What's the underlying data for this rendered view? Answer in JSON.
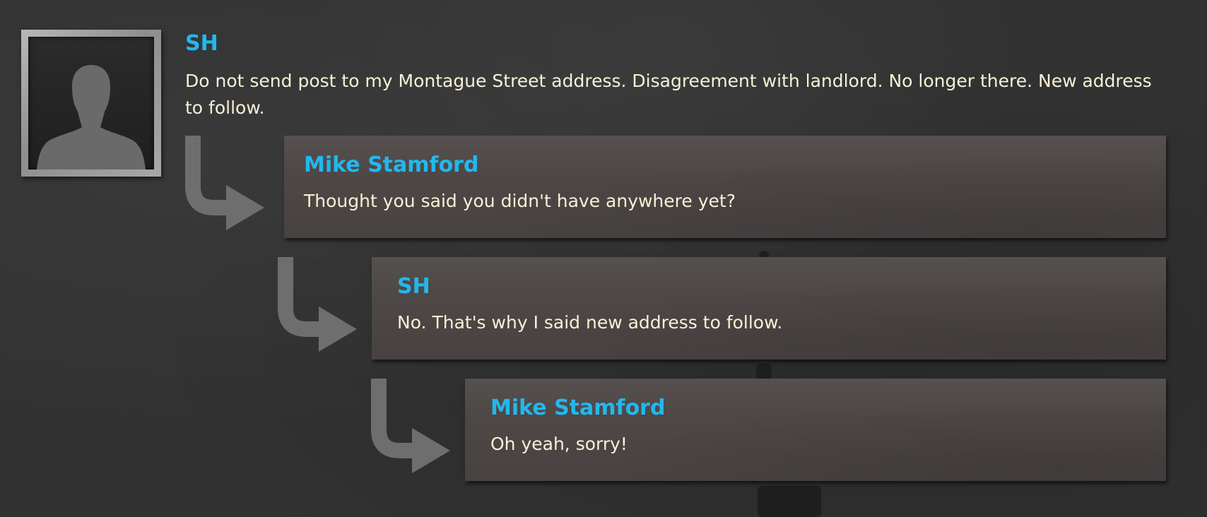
{
  "post": {
    "author": "SH",
    "text": "Do not send post to my Montague Street address. Disagreement with landlord. No longer there. New address to follow.",
    "avatar_icon": "silhouette-avatar-icon"
  },
  "replies": [
    {
      "author": "Mike Stamford",
      "text": "Thought you said you didn't have anywhere yet?"
    },
    {
      "author": "SH",
      "text": "No. That's why I said new address to follow."
    },
    {
      "author": "Mike Stamford",
      "text": "Oh yeah, sorry!"
    }
  ],
  "colors": {
    "author": "#22b8ee",
    "text": "#f6f1d6",
    "background": "#323232",
    "reply_box": "#4d4746",
    "arrow": "#6e6e6e"
  }
}
